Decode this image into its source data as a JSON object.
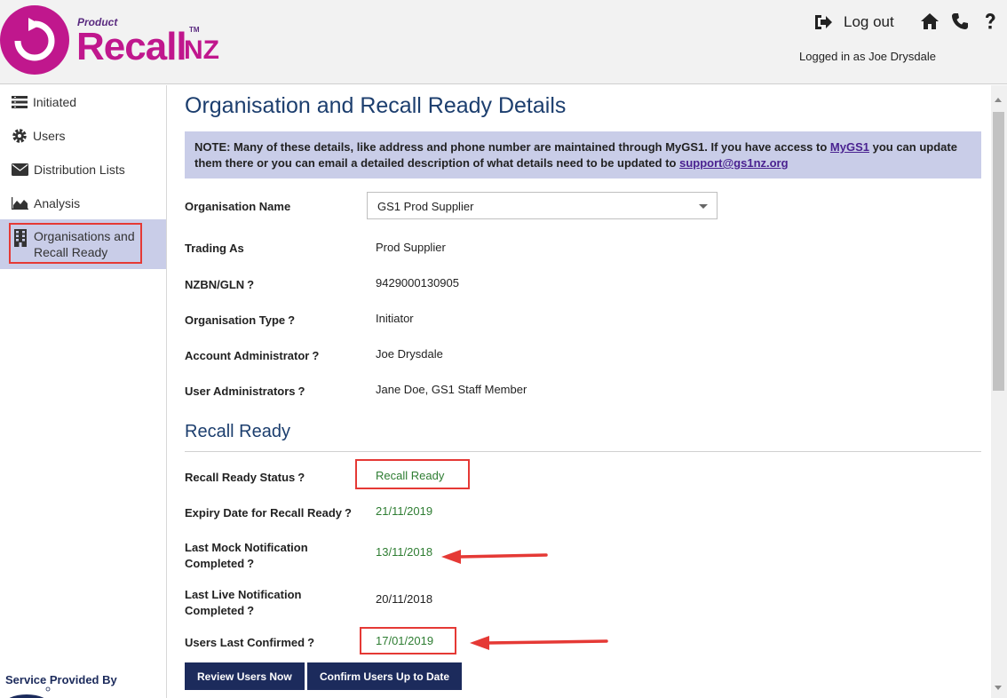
{
  "header": {
    "logo_product": "Product",
    "logo_main": "Recall",
    "logo_suffix": "NZ",
    "logo_tm": "TM",
    "logout_label": "Log out",
    "logged_in": "Logged in as Joe Drysdale",
    "icons": [
      "sign-out-icon",
      "home-icon",
      "phone-icon",
      "help-icon"
    ]
  },
  "sidebar": {
    "items": [
      {
        "label": "Initiated",
        "icon": "list-icon"
      },
      {
        "label": "Users",
        "icon": "gear-icon"
      },
      {
        "label": "Distribution Lists",
        "icon": "envelope-icon"
      },
      {
        "label": "Analysis",
        "icon": "area-chart-icon"
      },
      {
        "label": "Organisations and Recall Ready",
        "label_line1": "Organisations and",
        "label_line2": "Recall Ready",
        "icon": "building-icon",
        "active": true
      }
    ],
    "service": "Service Provided By"
  },
  "main": {
    "title": "Organisation and Recall Ready Details",
    "note": {
      "text1": "NOTE: Many of these details, like address and phone number are maintained through MyGS1. If you have access to ",
      "link1": "MyGS1",
      "text2": " you can update them there or you can email a detailed description of what details need to be updated to ",
      "link2": "support@gs1nz.org"
    },
    "org_name_label": "Organisation Name",
    "org_name_value": "GS1 Prod Supplier",
    "help": "?",
    "fields": [
      {
        "label": "Trading As",
        "value": "Prod Supplier"
      },
      {
        "label": "NZBN/GLN",
        "value": "9429000130905"
      },
      {
        "label": "Organisation Type",
        "value": "Initiator"
      },
      {
        "label": "Account Administrator",
        "value": "Joe Drysdale"
      },
      {
        "label": "User Administrators",
        "value": "Jane Doe, GS1 Staff Member"
      }
    ],
    "recall_section": "Recall Ready",
    "recall": {
      "status_label": "Recall Ready Status",
      "status_value": "Recall Ready",
      "expiry_label": "Expiry Date for Recall Ready",
      "expiry_value": "21/11/2019",
      "mock_label_1": "Last Mock Notification",
      "mock_label_2": "Completed",
      "mock_value": "13/11/2018",
      "live_label_1": "Last Live Notification",
      "live_label_2": "Completed",
      "live_value": "20/11/2018",
      "users_label": "Users Last Confirmed",
      "users_value": "17/01/2019"
    },
    "buttons": {
      "review": "Review Users Now",
      "confirm": "Confirm Users Up to Date"
    }
  },
  "colors": {
    "brand_pink": "#c0178d",
    "brand_purple": "#5a2b80",
    "navy": "#1c2b5c",
    "note_bg": "#c9cde8",
    "green": "#2e7d32",
    "annotation_red": "#e53935"
  }
}
